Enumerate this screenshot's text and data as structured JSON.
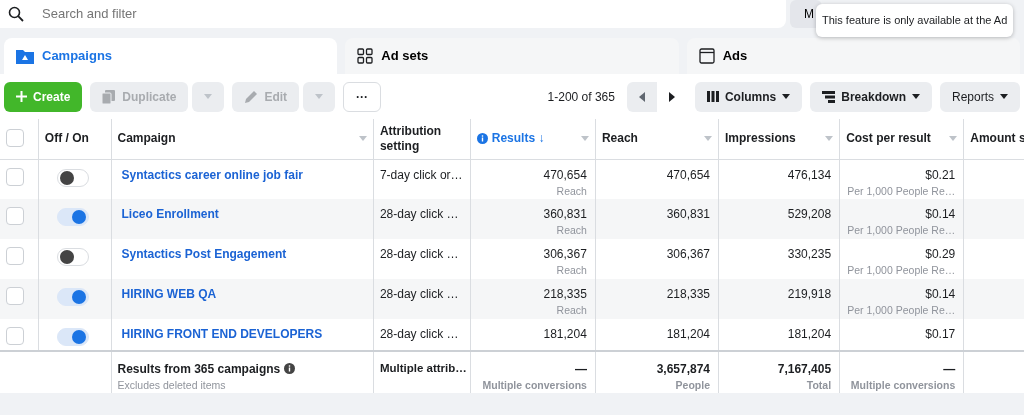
{
  "search": {
    "placeholder": "Search and filter"
  },
  "top_button": {
    "label": "M"
  },
  "tooltip": {
    "text": "This feature is only available at the Ad"
  },
  "tabs": [
    {
      "label": "Campaigns",
      "kind": "campaigns",
      "selected": true
    },
    {
      "label": "Ad sets",
      "kind": "adsets",
      "selected": false
    },
    {
      "label": "Ads",
      "kind": "ads",
      "selected": false
    }
  ],
  "toolbar": {
    "create": "Create",
    "duplicate": {
      "label": "Duplicate",
      "disabled": true
    },
    "edit": {
      "label": "Edit",
      "disabled": true
    },
    "more": "···",
    "pagination": "1-200 of 365",
    "columns": "Columns",
    "breakdown": "Breakdown",
    "reports": "Reports"
  },
  "table": {
    "select_all": {
      "checked": false
    },
    "columns": [
      {
        "label": "Off / On",
        "kind": "plain"
      },
      {
        "label": "Campaign",
        "kind": "menu"
      },
      {
        "label": "Attribution setting",
        "kind": "plain"
      },
      {
        "label": "Results ↓",
        "kind": "sorted"
      },
      {
        "label": "Reach",
        "kind": "menu"
      },
      {
        "label": "Impressions",
        "kind": "menu"
      },
      {
        "label": "Cost per result",
        "kind": "menu"
      },
      {
        "label": "Amount s",
        "kind": "plain"
      }
    ],
    "rows": [
      {
        "checked": false,
        "on": false,
        "campaign": "Syntactics career online job fair",
        "attribution": "7-day click or…",
        "results": "470,654",
        "results_sub": "Reach",
        "reach": "470,654",
        "impressions": "476,134",
        "cost": "$0.21",
        "cost_sub": "Per 1,000 People Re…"
      },
      {
        "checked": false,
        "on": true,
        "campaign": "Liceo Enrollment",
        "attribution": "28-day click …",
        "results": "360,831",
        "results_sub": "Reach",
        "reach": "360,831",
        "impressions": "529,208",
        "cost": "$0.14",
        "cost_sub": "Per 1,000 People Re…"
      },
      {
        "checked": false,
        "on": false,
        "campaign": "Syntactics Post Engagement",
        "attribution": "28-day click …",
        "results": "306,367",
        "results_sub": "Reach",
        "reach": "306,367",
        "impressions": "330,235",
        "cost": "$0.29",
        "cost_sub": "Per 1,000 People Re…"
      },
      {
        "checked": false,
        "on": true,
        "campaign": "HIRING WEB QA",
        "attribution": "28-day click …",
        "results": "218,335",
        "results_sub": "Reach",
        "reach": "218,335",
        "impressions": "219,918",
        "cost": "$0.14",
        "cost_sub": "Per 1,000 People Re…"
      },
      {
        "checked": false,
        "on": true,
        "campaign": "HIRING FRONT END DEVELOPERS",
        "attribution": "28-day click …",
        "results": "181,204",
        "reach": "181,204",
        "impressions": "181,204",
        "cost": "$0.17"
      }
    ],
    "footer": {
      "title": "Results from 365 campaigns",
      "note": "Excludes deleted items",
      "attribution": "Multiple attrib…",
      "results": "—",
      "results_sub": "Multiple conversions",
      "reach": "3,657,874",
      "reach_sub": "People",
      "impressions": "7,167,405",
      "impressions_sub": "Total",
      "cost": "—",
      "cost_sub": "Multiple conversions"
    }
  }
}
